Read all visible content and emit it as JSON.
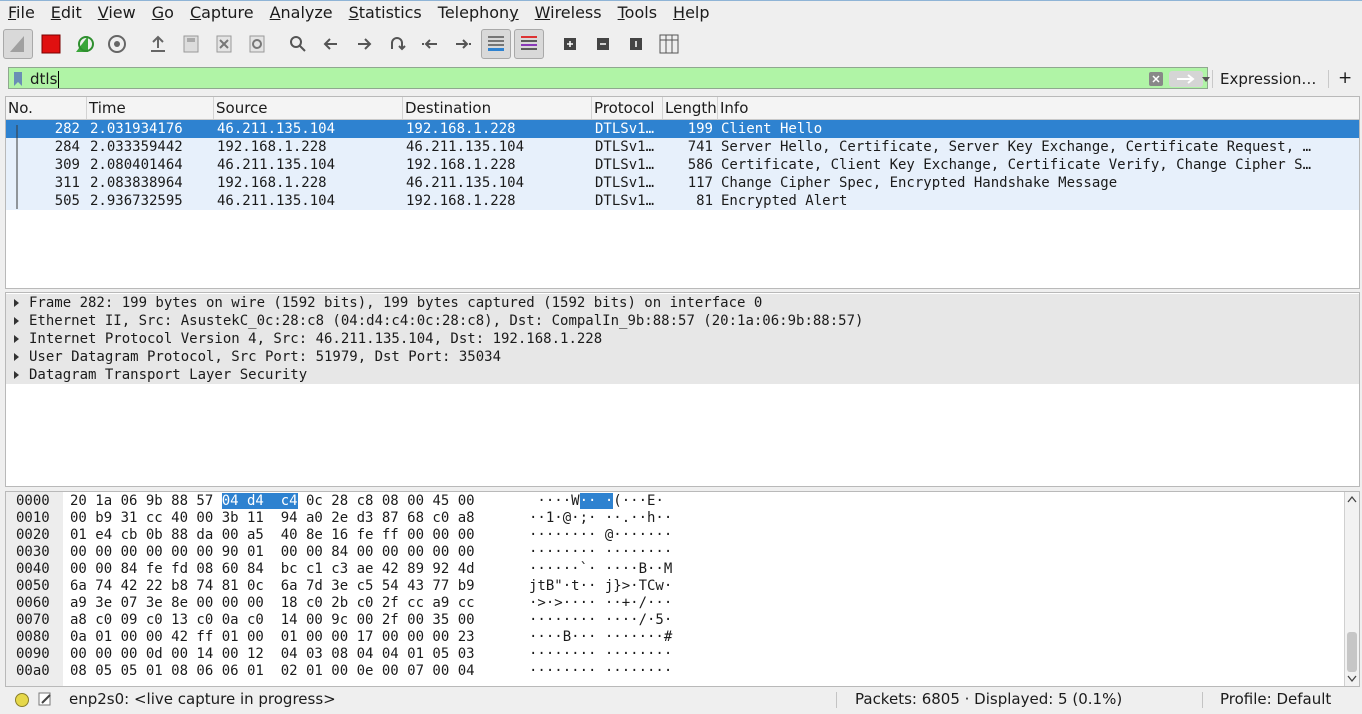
{
  "menu": [
    "File",
    "Edit",
    "View",
    "Go",
    "Capture",
    "Analyze",
    "Statistics",
    "Telephony",
    "Wireless",
    "Tools",
    "Help"
  ],
  "menu_underline": [
    "F",
    "E",
    "V",
    "G",
    "C",
    "A",
    "S",
    "y",
    "W",
    "T",
    "H"
  ],
  "toolbar_icons": [
    "shark-fin-start-icon",
    "stop-capture-icon",
    "restart-capture-icon",
    "capture-options-icon",
    "open-file-icon",
    "save-file-icon",
    "close-file-icon",
    "reload-file-icon",
    "find-packet-icon",
    "go-back-icon",
    "go-forward-icon",
    "go-to-packet-icon",
    "go-first-icon",
    "go-last-icon",
    "autoscroll-icon",
    "colorize-icon",
    "zoom-in-icon",
    "zoom-out-icon",
    "normal-size-icon",
    "resize-columns-icon"
  ],
  "filter": {
    "value": "dtls",
    "expression_label": "Expression…",
    "add_label": "+"
  },
  "packet_list": {
    "columns": [
      "No.",
      "Time",
      "Source",
      "Destination",
      "Protocol",
      "Length",
      "Info"
    ],
    "rows": [
      {
        "no": "282",
        "time": "2.031934176",
        "src": "46.211.135.104",
        "dst": "192.168.1.228",
        "proto": "DTLSv1…",
        "len": "199",
        "info": "Client Hello",
        "selected": true
      },
      {
        "no": "284",
        "time": "2.033359442",
        "src": "192.168.1.228",
        "dst": "46.211.135.104",
        "proto": "DTLSv1…",
        "len": "741",
        "info": "Server Hello, Certificate, Server Key Exchange, Certificate Request, …"
      },
      {
        "no": "309",
        "time": "2.080401464",
        "src": "46.211.135.104",
        "dst": "192.168.1.228",
        "proto": "DTLSv1…",
        "len": "586",
        "info": "Certificate, Client Key Exchange, Certificate Verify, Change Cipher S…"
      },
      {
        "no": "311",
        "time": "2.083838964",
        "src": "192.168.1.228",
        "dst": "46.211.135.104",
        "proto": "DTLSv1…",
        "len": "117",
        "info": "Change Cipher Spec, Encrypted Handshake Message"
      },
      {
        "no": "505",
        "time": "2.936732595",
        "src": "46.211.135.104",
        "dst": "192.168.1.228",
        "proto": "DTLSv1…",
        "len": "81",
        "info": "Encrypted Alert"
      }
    ]
  },
  "details": [
    "Frame 282: 199 bytes on wire (1592 bits), 199 bytes captured (1592 bits) on interface 0",
    "Ethernet II, Src: AsustekC_0c:28:c8 (04:d4:c4:0c:28:c8), Dst: CompalIn_9b:88:57 (20:1a:06:9b:88:57)",
    "Internet Protocol Version 4, Src: 46.211.135.104, Dst: 192.168.1.228",
    "User Datagram Protocol, Src Port: 51979, Dst Port: 35034",
    "Datagram Transport Layer Security"
  ],
  "hex": [
    {
      "off": "0000",
      "pre": "20 1a 06 9b 88 57 ",
      "hl": "04 d4  c4",
      "post": " 0c 28 c8 08 00 45 00",
      "apre": " ····W",
      "ahl": "·· ·",
      "apost": "(···E·"
    },
    {
      "off": "0010",
      "pre": "00 b9 31 cc 40 00 3b 11  94 a0 2e d3 87 68 c0 a8",
      "hl": "",
      "post": "",
      "apre": "··1·@·;· ··.··h··",
      "ahl": "",
      "apost": ""
    },
    {
      "off": "0020",
      "pre": "01 e4 cb 0b 88 da 00 a5  40 8e 16 fe ff 00 00 00",
      "hl": "",
      "post": "",
      "apre": "········ @·······",
      "ahl": "",
      "apost": ""
    },
    {
      "off": "0030",
      "pre": "00 00 00 00 00 00 90 01  00 00 84 00 00 00 00 00",
      "hl": "",
      "post": "",
      "apre": "········ ········",
      "ahl": "",
      "apost": ""
    },
    {
      "off": "0040",
      "pre": "00 00 84 fe fd 08 60 84  bc c1 c3 ae 42 89 92 4d",
      "hl": "",
      "post": "",
      "apre": "······`· ····B··M",
      "ahl": "",
      "apost": ""
    },
    {
      "off": "0050",
      "pre": "6a 74 42 22 b8 74 81 0c  6a 7d 3e c5 54 43 77 b9",
      "hl": "",
      "post": "",
      "apre": "jtB\"·t·· j}>·TCw·",
      "ahl": "",
      "apost": ""
    },
    {
      "off": "0060",
      "pre": "a9 3e 07 3e 8e 00 00 00  18 c0 2b c0 2f cc a9 cc",
      "hl": "",
      "post": "",
      "apre": "·>·>···· ··+·/···",
      "ahl": "",
      "apost": ""
    },
    {
      "off": "0070",
      "pre": "a8 c0 09 c0 13 c0 0a c0  14 00 9c 00 2f 00 35 00",
      "hl": "",
      "post": "",
      "apre": "········ ····/·5·",
      "ahl": "",
      "apost": ""
    },
    {
      "off": "0080",
      "pre": "0a 01 00 00 42 ff 01 00  01 00 00 17 00 00 00 23",
      "hl": "",
      "post": "",
      "apre": "····B··· ·······#",
      "ahl": "",
      "apost": ""
    },
    {
      "off": "0090",
      "pre": "00 00 00 0d 00 14 00 12  04 03 08 04 04 01 05 03",
      "hl": "",
      "post": "",
      "apre": "········ ········",
      "ahl": "",
      "apost": ""
    },
    {
      "off": "00a0",
      "pre": "08 05 05 01 08 06 06 01  02 01 00 0e 00 07 00 04",
      "hl": "",
      "post": "",
      "apre": "········ ········",
      "ahl": "",
      "apost": ""
    }
  ],
  "status": {
    "capture": "enp2s0: <live capture in progress>",
    "packets": "Packets: 6805 · Displayed: 5 (0.1%)",
    "profile": "Profile: Default"
  },
  "colors": {
    "selection": "#2e82d0",
    "row_bg": "#e7f0fb",
    "filter_ok": "#b0f4a6"
  }
}
